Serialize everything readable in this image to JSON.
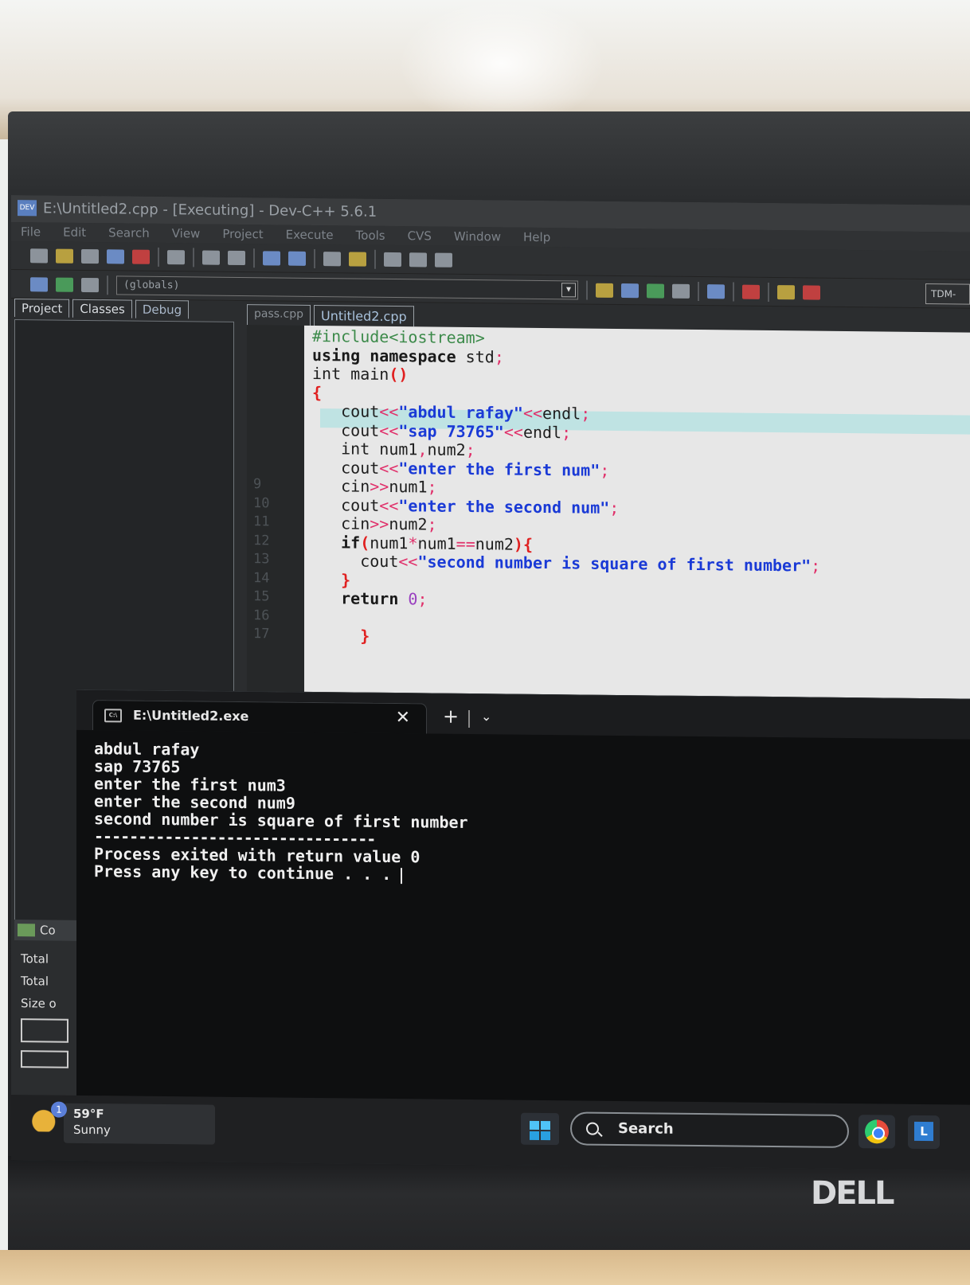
{
  "window": {
    "title": "E:\\Untitled2.cpp - [Executing] - Dev-C++ 5.6.1",
    "app_icon_text": "DEV"
  },
  "menu": [
    "File",
    "Edit",
    "Search",
    "View",
    "Project",
    "Execute",
    "Tools",
    "CVS",
    "Window",
    "Help"
  ],
  "toolbar": {
    "scope_select": "(globals)",
    "compiler_select": "TDM-"
  },
  "left_panel": {
    "tabs": [
      "Project",
      "Classes",
      "Debug"
    ],
    "bottom_header": "Co",
    "bottom_labels": [
      "Total",
      "Total",
      "Size o"
    ]
  },
  "file_tabs": [
    "pass.cpp",
    "Untitled2.cpp"
  ],
  "line_numbers": [
    "9",
    "10",
    "11",
    "12",
    "13",
    "14",
    "15",
    "16",
    "17"
  ],
  "code_lines": [
    "#include<iostream>",
    "using namespace std;",
    "int main()",
    "{",
    "   cout<<\"abdul rafay\"<<endl;",
    "   cout<<\"sap 73765\"<<endl;",
    "   int num1,num2;",
    "   cout<<\"enter the first num\";",
    "   cin>>num1;",
    "   cout<<\"enter the second num\";",
    "   cin>>num2;",
    "   if(num1*num1==num2){",
    "     cout<<\"second number is square of first number\";",
    "   }",
    "   return 0;",
    "",
    "     }"
  ],
  "console": {
    "tab_title": "E:\\Untitled2.exe",
    "close_glyph": "✕",
    "new_tab_glyph": "+",
    "dropdown_glyph": "⌄",
    "output": [
      "abdul rafay",
      "sap 73765",
      "enter the first num3",
      "enter the second num9",
      "second number is square of first number",
      "--------------------------------",
      "Process exited with return value 0",
      "Press any key to continue . . . "
    ]
  },
  "taskbar": {
    "weather_temp": "59°F",
    "weather_condition": "Sunny",
    "weather_badge": "1",
    "search_label": "Search"
  },
  "monitor_brand": "DELL"
}
